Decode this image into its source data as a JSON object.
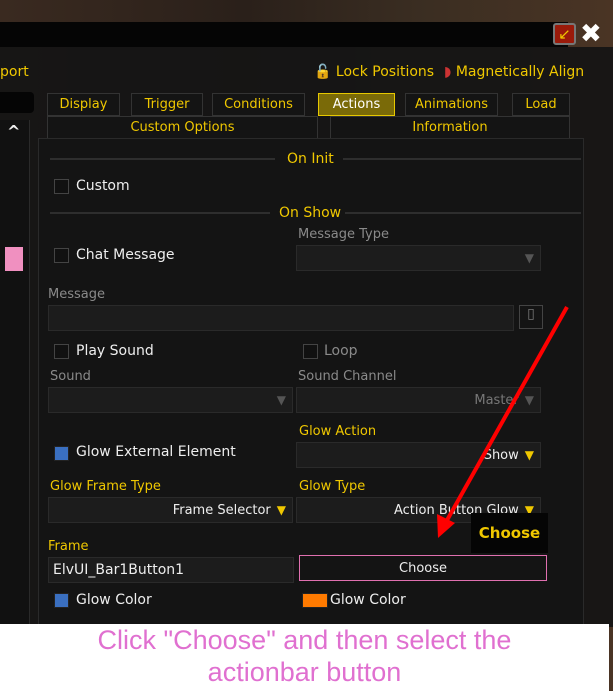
{
  "window": {
    "minimize_icon": "collapse-arrow-icon",
    "close_icon": "close-icon"
  },
  "toolbar": {
    "partial_label": "port",
    "lock_positions": "Lock Positions",
    "magnetically_align": "Magnetically Align"
  },
  "tabs": [
    {
      "label": "Display"
    },
    {
      "label": "Trigger"
    },
    {
      "label": "Conditions"
    },
    {
      "label": "Actions",
      "selected": true
    },
    {
      "label": "Animations"
    },
    {
      "label": "Load"
    }
  ],
  "subtabs": [
    {
      "label": "Custom Options"
    },
    {
      "label": "Information"
    }
  ],
  "on_init": {
    "header": "On Init",
    "custom_label": "Custom",
    "custom_checked": false
  },
  "on_show": {
    "header": "On Show",
    "chat_message": {
      "label": "Chat Message",
      "checked": false
    },
    "message_type": {
      "label": "Message Type",
      "value": ""
    },
    "message": {
      "label": "Message",
      "value": ""
    },
    "play_sound": {
      "label": "Play Sound",
      "checked": false
    },
    "loop": {
      "label": "Loop",
      "checked": false
    },
    "sound": {
      "label": "Sound",
      "value": ""
    },
    "sound_channel": {
      "label": "Sound Channel",
      "value": "Master"
    },
    "glow_external": {
      "label": "Glow External Element",
      "checked": true
    },
    "glow_action": {
      "label": "Glow Action",
      "value": "Show"
    },
    "glow_frame_type": {
      "label": "Glow Frame Type",
      "value": "Frame Selector"
    },
    "glow_type": {
      "label": "Glow Type",
      "value": "Action Button Glow"
    },
    "frame": {
      "label": "Frame",
      "value": "ElvUI_Bar1Button1",
      "choose_label": "Choose"
    },
    "glow_color_1": {
      "label": "Glow Color",
      "color": "#3a6fc0"
    },
    "glow_color_2": {
      "label": "Glow Color",
      "color": "#ff7a00"
    }
  },
  "tooltip": {
    "text": "Choose"
  },
  "annotation": {
    "caption": "Click \"Choose\" and then select the actionbar button",
    "arrow_color": "#ff0000"
  },
  "colors": {
    "accent": "#f0c800",
    "highlight_border": "#e070b0",
    "caption": "#e070d0"
  }
}
